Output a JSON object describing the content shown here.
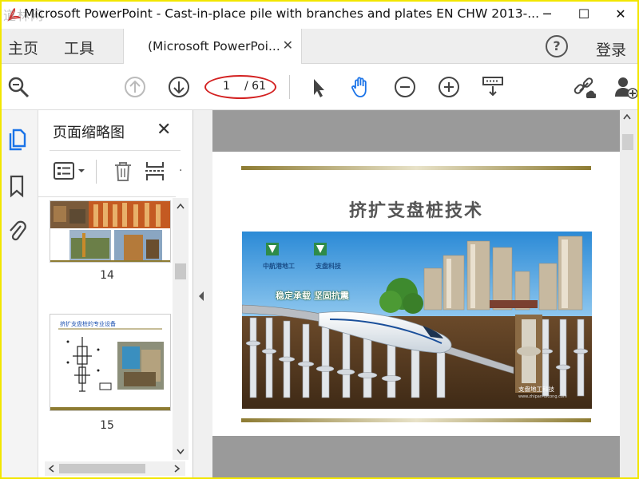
{
  "window": {
    "title": "Microsoft PowerPoint - Cast-in-place pile with branches and plates EN CHW 2013-...",
    "watermark": "道林网",
    "minimize": "─",
    "maximize": "☐",
    "close": "✕"
  },
  "menu": {
    "home": "主页",
    "tools": "工具",
    "doc_tab": "(Microsoft PowerPoi...",
    "doc_tab_close": "✕",
    "help": "?",
    "login": "登录"
  },
  "toolbar": {
    "page_current": "1",
    "page_total": "/ 61"
  },
  "thumb_panel": {
    "title": "页面缩略图",
    "close": "✕",
    "more": ".",
    "thumbs": [
      {
        "page": "14"
      },
      {
        "page": "15",
        "heading": "挤扩支盘桩的专业设备"
      }
    ]
  },
  "slide": {
    "title": "挤扩支盘桩技术",
    "logo1": "中航港地工",
    "logo2": "支盘科技",
    "slogan": "稳定承载 坚固抗震",
    "company": "支盘地工科技",
    "website": "www.zhipan-dicong.com"
  },
  "colors": {
    "accent_blue": "#1a73e8",
    "gold": "#8d7b32",
    "annotation_red": "#d32020",
    "frame_yellow": "#f2e600"
  }
}
